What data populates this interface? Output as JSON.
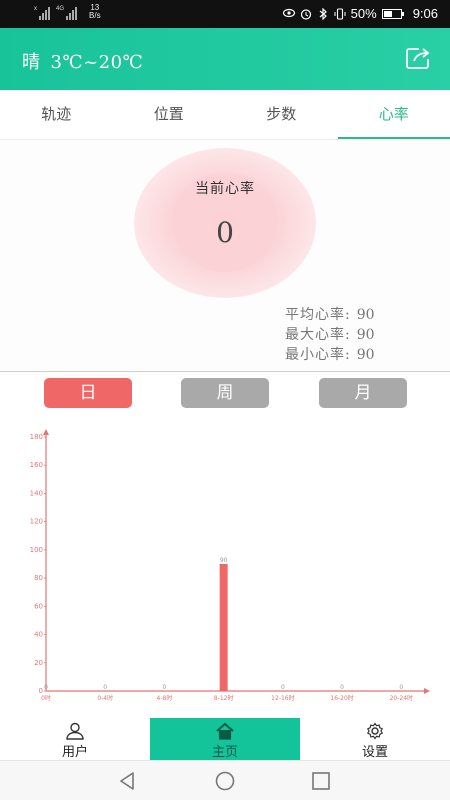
{
  "status_bar": {
    "net_tag_1": "x",
    "net_tag_2": "4G",
    "net_speed_value": "13",
    "net_speed_unit": "B/s",
    "battery_percent": "50%",
    "battery_level": 0.5,
    "time": "9:06",
    "icons": [
      "eye-icon",
      "alarm-icon",
      "bluetooth-icon",
      "vibrate-icon",
      "battery-icon"
    ]
  },
  "header": {
    "weather_condition": "晴",
    "temperature_range": "3℃~20℃",
    "share_icon": "share-icon",
    "background_color": "#1ec79d"
  },
  "tabs": [
    {
      "label": "轨迹",
      "active": false
    },
    {
      "label": "位置",
      "active": false
    },
    {
      "label": "步数",
      "active": false
    },
    {
      "label": "心率",
      "active": true
    }
  ],
  "heart_rate": {
    "title": "当前心率",
    "current_value": "0",
    "stats": [
      {
        "label": "平均心率:",
        "value": "90"
      },
      {
        "label": "最大心率:",
        "value": "90"
      },
      {
        "label": "最小心率:",
        "value": "90"
      }
    ]
  },
  "period_buttons": [
    {
      "label": "日",
      "active": true,
      "color": "#f06768"
    },
    {
      "label": "周",
      "active": false,
      "color": "#a9a9a9"
    },
    {
      "label": "月",
      "active": false,
      "color": "#a9a9a9"
    }
  ],
  "chart_data": {
    "type": "bar",
    "categories": [
      "0-4时",
      "4-8时",
      "8-12时",
      "12-16时",
      "16-20时",
      "20-24时"
    ],
    "values": [
      0,
      0,
      90,
      0,
      0,
      0
    ],
    "value_labels": [
      "0",
      "0",
      "0",
      "90",
      "0",
      "0",
      "0"
    ],
    "x_axis_labels": [
      "0时",
      "0-4时",
      "4-8时",
      "8-12时",
      "12-16时",
      "16-20时",
      "20-24时"
    ],
    "y_ticks": [
      "0",
      "20",
      "40",
      "60",
      "80",
      "100",
      "120",
      "140",
      "160",
      "180"
    ],
    "ylim": [
      0,
      180
    ],
    "grid": false,
    "bar_color": "#f06768",
    "axis_color": "#e37575"
  },
  "bottom_nav": [
    {
      "label": "用户",
      "icon": "user-icon",
      "active": false
    },
    {
      "label": "主页",
      "icon": "home-icon",
      "active": true
    },
    {
      "label": "设置",
      "icon": "gear-icon",
      "active": false
    }
  ],
  "system_nav": [
    "back-icon",
    "home-circle-icon",
    "recents-icon"
  ]
}
